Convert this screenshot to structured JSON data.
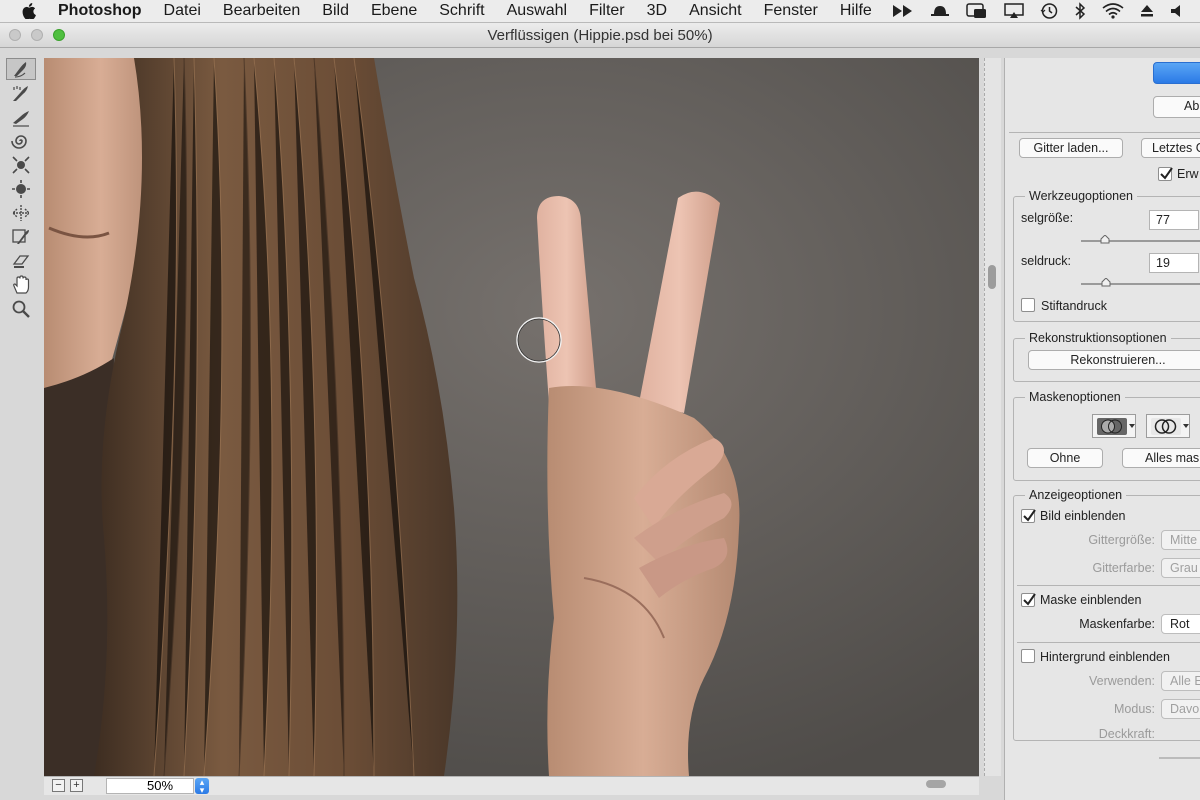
{
  "menubar": {
    "app_name": "Photoshop",
    "items": [
      "Datei",
      "Bearbeiten",
      "Bild",
      "Ebene",
      "Schrift",
      "Auswahl",
      "Filter",
      "3D",
      "Ansicht",
      "Fenster",
      "Hilfe"
    ],
    "status_icons": [
      "fast-forward-icon",
      "hat-icon",
      "window-icon",
      "airplay-icon",
      "time-machine-icon",
      "bluetooth-icon",
      "wifi-icon",
      "eject-icon",
      "volume-icon"
    ]
  },
  "window": {
    "title": "Verflüssigen (Hippie.psd bei 50%)"
  },
  "tools": [
    "forward-warp-icon",
    "reconstruct-icon",
    "smooth-icon",
    "twirl-icon",
    "pucker-icon",
    "bloat-icon",
    "push-left-icon",
    "freeze-mask-icon",
    "thaw-mask-icon",
    "hand-icon",
    "zoom-icon"
  ],
  "canvas": {
    "zoom_value": "50%"
  },
  "panel": {
    "ok_label": "",
    "cancel_label": "Ab",
    "load_mesh_label": "Gitter laden...",
    "last_mesh_label": "Letztes G",
    "advanced_label": "Erw",
    "advanced_checked": true,
    "tool_options": {
      "title": "Werkzeugoptionen",
      "brush_size_label": "selgröße:",
      "brush_size_value": "77",
      "brush_pressure_label": "seldruck:",
      "brush_pressure_value": "19",
      "stylus_label": "Stiftandruck",
      "stylus_checked": false
    },
    "reconstruct_options": {
      "title": "Rekonstruktionsoptionen",
      "button_label": "Rekonstruieren..."
    },
    "mask_options": {
      "title": "Maskenoptionen",
      "none_label": "Ohne",
      "mask_all_label": "Alles mas"
    },
    "view_options": {
      "title": "Anzeigeoptionen",
      "show_image_label": "Bild einblenden",
      "show_image_checked": true,
      "mesh_size_label": "Gittergröße:",
      "mesh_size_value": "Mitte",
      "mesh_color_label": "Gitterfarbe:",
      "mesh_color_value": "Grau",
      "show_mask_label": "Maske einblenden",
      "show_mask_checked": true,
      "mask_color_label": "Maskenfarbe:",
      "mask_color_value": "Rot",
      "show_backdrop_label": "Hintergrund einblenden",
      "show_backdrop_checked": false,
      "use_label": "Verwenden:",
      "use_value": "Alle E",
      "mode_label": "Modus:",
      "mode_value": "Davor",
      "opacity_label": "Deckkraft:"
    }
  },
  "colors": {
    "accent_blue": "#2b7ae6",
    "panel_bg": "#e6e6e6",
    "canvas_bg": "#65615e"
  }
}
